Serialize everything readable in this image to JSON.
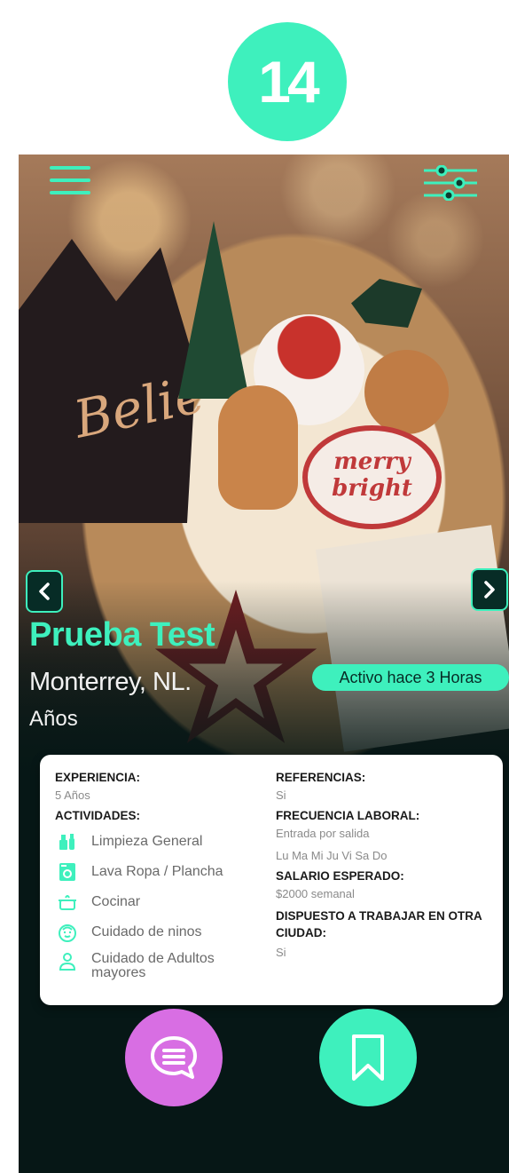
{
  "step_number": "14",
  "header": {
    "menu_icon": "hamburger-menu-icon",
    "filter_icon": "sliders-filter-icon"
  },
  "hero": {
    "background": "christmas-cookies-photo",
    "crown_lettering": "Belie",
    "cookie_lettering": "merry bright"
  },
  "profile": {
    "name": "Prueba Test",
    "location": "Monterrey, NL.",
    "age_label": "Años",
    "status": "Activo hace 3 Horas"
  },
  "details": {
    "experience_label": "EXPERIENCIA:",
    "experience_value": "5 Años",
    "activities_label": "ACTIVIDADES:",
    "activities": [
      {
        "icon": "cleaning-icon",
        "label": "Limpieza General"
      },
      {
        "icon": "washing-machine-icon",
        "label": "Lava Ropa / Plancha"
      },
      {
        "icon": "cooking-pot-icon",
        "label": "Cocinar"
      },
      {
        "icon": "child-face-icon",
        "label": "Cuidado de ninos"
      },
      {
        "icon": "person-icon",
        "label": "Cuidado de Adultos mayores"
      }
    ],
    "references_label": "REFERENCIAS:",
    "references_value": "Si",
    "frequency_label": "FRECUENCIA LABORAL:",
    "frequency_value": "Entrada por salida",
    "days_value": "Lu Ma Mi Ju Vi Sa Do",
    "salary_label": "SALARIO ESPERADO:",
    "salary_value": "$2000 semanal",
    "relocate_label": "DISPUESTO A TRABAJAR EN OTRA CIUDAD:",
    "relocate_value": "Si"
  },
  "actions": {
    "chat_icon": "chat-bubble-icon",
    "save_icon": "bookmark-icon"
  },
  "colors": {
    "accent": "#3ef0bd",
    "chat": "#d86ee3",
    "dark": "#061716"
  }
}
